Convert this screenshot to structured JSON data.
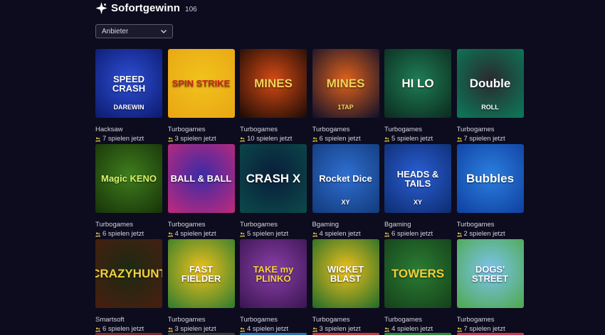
{
  "header": {
    "title": "Sofortgewinn",
    "count": "106",
    "logo_icon": "sparkle-icon"
  },
  "filter": {
    "label": "Anbieter",
    "icon": "chevron-down-icon"
  },
  "games": [
    {
      "title": "SPEED CRASH",
      "subtitle": "DAREWIN",
      "provider": "Hacksaw",
      "players": "7 spielen jetzt",
      "bg": "#2d4fd6",
      "bg2": "#0c1a6e",
      "fg": "#ffffff"
    },
    {
      "title": "SPIN STRIKE",
      "subtitle": "",
      "provider": "Turbogames",
      "players": "3 spielen jetzt",
      "bg": "#f1c31c",
      "bg2": "#e9a514",
      "fg": "#c8261e"
    },
    {
      "title": "MINES",
      "subtitle": "",
      "provider": "Turbogames",
      "players": "10 spielen jetzt",
      "bg": "#d64b14",
      "bg2": "#1a0a05",
      "fg": "#f2d25a"
    },
    {
      "title": "MINES",
      "subtitle": "1TAP",
      "provider": "Turbogames",
      "players": "6 spielen jetzt",
      "bg": "#e0621a",
      "bg2": "#0e0f2a",
      "fg": "#f2d25a"
    },
    {
      "title": "HI LO",
      "subtitle": "",
      "provider": "Turbogames",
      "players": "5 spielen jetzt",
      "bg": "#1f7d55",
      "bg2": "#0b2a1f",
      "fg": "#ffffff"
    },
    {
      "title": "Double",
      "subtitle": "ROLL",
      "provider": "Turbogames",
      "players": "7 spielen jetzt",
      "bg": "#2a2a2e",
      "bg2": "#0b7a5a",
      "fg": "#ffffff"
    },
    {
      "title": "Magic KENO",
      "subtitle": "",
      "provider": "Turbogames",
      "players": "6 spielen jetzt",
      "bg": "#3f7d1c",
      "bg2": "#17330a",
      "fg": "#d8f06a"
    },
    {
      "title": "BALL & BALL",
      "subtitle": "",
      "provider": "Turbogames",
      "players": "4 spielen jetzt",
      "bg": "#3b2aa6",
      "bg2": "#c02a7a",
      "fg": "#ffffff"
    },
    {
      "title": "CRASH X",
      "subtitle": "",
      "provider": "Turbogames",
      "players": "5 spielen jetzt",
      "bg": "#0a1d3a",
      "bg2": "#0b4a4a",
      "fg": "#ffffff"
    },
    {
      "title": "Rocket Dice",
      "subtitle": "XY",
      "provider": "Bgaming",
      "players": "4 spielen jetzt",
      "bg": "#2f6fd1",
      "bg2": "#123a7a",
      "fg": "#ffffff"
    },
    {
      "title": "HEADS & TAILS",
      "subtitle": "XY",
      "provider": "Bgaming",
      "players": "6 spielen jetzt",
      "bg": "#2a5fd6",
      "bg2": "#0d2c6e",
      "fg": "#ffffff"
    },
    {
      "title": "Bubbles",
      "subtitle": "",
      "provider": "Turbogames",
      "players": "2 spielen jetzt",
      "bg": "#2b7fe0",
      "bg2": "#0f3f9e",
      "fg": "#ffffff"
    },
    {
      "title": "CRAZYHUNT",
      "subtitle": "",
      "provider": "Smartsoft",
      "players": "6 spielen jetzt",
      "bg": "#1b2a12",
      "bg2": "#4a1e10",
      "fg": "#f0d040"
    },
    {
      "title": "FAST FIELDER",
      "subtitle": "",
      "provider": "Turbogames",
      "players": "3 spielen jetzt",
      "bg": "#f0c21c",
      "bg2": "#2e7a2e",
      "fg": "#ffffff"
    },
    {
      "title": "TAKE my PLINKO",
      "subtitle": "",
      "provider": "Turbogames",
      "players": "4 spielen jetzt",
      "bg": "#8a3fa8",
      "bg2": "#3a1550",
      "fg": "#f4d23a"
    },
    {
      "title": "WICKET BLAST",
      "subtitle": "",
      "provider": "Turbogames",
      "players": "3 spielen jetzt",
      "bg": "#f0c21c",
      "bg2": "#1f6a2a",
      "fg": "#ffffff"
    },
    {
      "title": "TOWERS",
      "subtitle": "",
      "provider": "Turbogames",
      "players": "4 spielen jetzt",
      "bg": "#2b7d33",
      "bg2": "#15401a",
      "fg": "#f3cf3a"
    },
    {
      "title": "DOGS' STREET",
      "subtitle": "",
      "provider": "Turbogames",
      "players": "7 spielen jetzt",
      "bg": "#7cc4f0",
      "bg2": "#4da84a",
      "fg": "#ffffff"
    }
  ],
  "partial_row_colors": [
    "#7a2a2a",
    "#3a3a3a",
    "#2a6fb5",
    "#c83a3a",
    "#2c8a3a",
    "#c8364a"
  ]
}
